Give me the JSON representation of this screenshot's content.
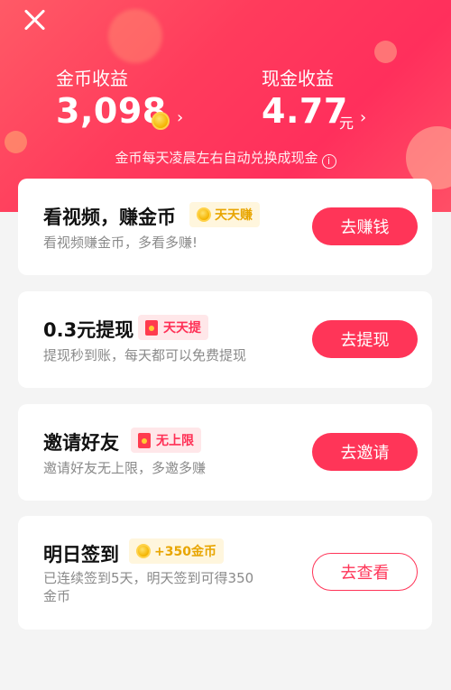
{
  "header": {
    "close_label": "",
    "coins_label": "金币收益",
    "coins_value": "3,098",
    "cash_label": "现金收益",
    "cash_value": "4.77",
    "cash_unit": "元",
    "chevron": "›",
    "note": "金币每天凌晨左右自动兑换成现金",
    "info_icon": "i"
  },
  "cards": [
    {
      "title": "看视频，赚金币",
      "tag": "天天赚",
      "tag_icon": "coin-icon",
      "subtitle": "看视频赚金币，多看多赚!",
      "button": "去赚钱"
    },
    {
      "title": "0.3元提现",
      "tag": "天天提",
      "tag_icon": "red-envelope-icon",
      "subtitle": "提现秒到账，每天都可以免费提现",
      "button": "去提现"
    },
    {
      "title": "邀请好友",
      "tag": "无上限",
      "tag_icon": "red-envelope-icon",
      "subtitle": "邀请好友无上限，多邀多赚",
      "button": "去邀请"
    },
    {
      "title": "明日签到",
      "tag": "+350金币",
      "tag_icon": "coin-icon",
      "subtitle_line1": "已连续签到5天，明天签到可得350",
      "subtitle_line2": "金币",
      "button": "去查看"
    }
  ],
  "colors": {
    "accent": "#ff3558",
    "gold": "#e8a500",
    "background": "#f4f4f4"
  }
}
